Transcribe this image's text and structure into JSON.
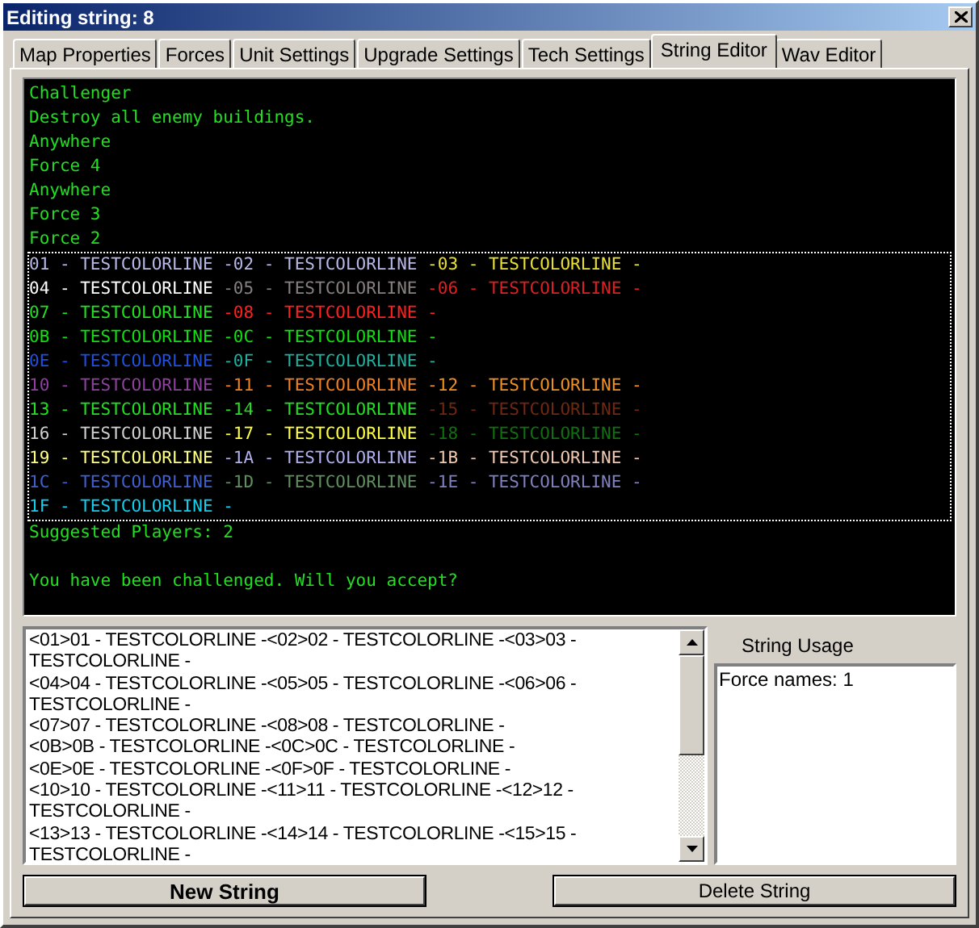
{
  "window": {
    "title": "Editing string: 8"
  },
  "tabs": [
    {
      "label": "Map Properties",
      "selected": false
    },
    {
      "label": "Forces",
      "selected": false
    },
    {
      "label": "Unit Settings",
      "selected": false
    },
    {
      "label": "Upgrade Settings",
      "selected": false
    },
    {
      "label": "Tech Settings",
      "selected": false
    },
    {
      "label": "String Editor",
      "selected": true
    },
    {
      "label": "Wav Editor",
      "selected": false
    }
  ],
  "string_list": [
    {
      "kind": "text",
      "selected": false,
      "text": "Challenger"
    },
    {
      "kind": "text",
      "selected": false,
      "text": "Destroy all enemy buildings."
    },
    {
      "kind": "text",
      "selected": false,
      "text": "Anywhere"
    },
    {
      "kind": "text",
      "selected": false,
      "text": "Force 4"
    },
    {
      "kind": "text",
      "selected": false,
      "text": "Anywhere"
    },
    {
      "kind": "text",
      "selected": false,
      "text": "Force 3"
    },
    {
      "kind": "text",
      "selected": false,
      "text": "Force 2"
    },
    {
      "kind": "colored",
      "selected": true,
      "lines": [
        [
          {
            "text": "01 - TESTCOLORLINE ",
            "color": "#b8b8e8"
          },
          {
            "text": "-02 - TESTCOLORLINE ",
            "color": "#b8b8e8"
          },
          {
            "text": "-03 - TESTCOLORLINE -",
            "color": "#e8e030"
          }
        ],
        [
          {
            "text": "04 - TESTCOLORLINE ",
            "color": "#ffffff"
          },
          {
            "text": "-05 - TESTCOLORLINE ",
            "color": "#888080"
          },
          {
            "text": "-06 - TESTCOLORLINE -",
            "color": "#e02020"
          }
        ],
        [
          {
            "text": "07 - TESTCOLORLINE ",
            "color": "#20e020"
          },
          {
            "text": "-08 - TESTCOLORLINE -",
            "color": "#ff2020"
          }
        ],
        [
          {
            "text": "0B - TESTCOLORLINE ",
            "color": "#10e010"
          },
          {
            "text": "-0C - TESTCOLORLINE -",
            "color": "#10e010"
          }
        ],
        [
          {
            "text": "0E - TESTCOLORLINE ",
            "color": "#2050e0"
          },
          {
            "text": "-0F - TESTCOLORLINE -",
            "color": "#20b0a0"
          }
        ],
        [
          {
            "text": "10 - TESTCOLORLINE ",
            "color": "#9040a0"
          },
          {
            "text": "-11 - TESTCOLORLINE ",
            "color": "#f08020"
          },
          {
            "text": "-12 - TESTCOLORLINE -",
            "color": "#f09020"
          }
        ],
        [
          {
            "text": "13 - TESTCOLORLINE ",
            "color": "#20e020"
          },
          {
            "text": "-14 - TESTCOLORLINE ",
            "color": "#20e020"
          },
          {
            "text": "-15 - TESTCOLORLINE -",
            "color": "#702810"
          }
        ],
        [
          {
            "text": "16 - TESTCOLORLINE ",
            "color": "#d0d0d0"
          },
          {
            "text": "-17 - TESTCOLORLINE ",
            "color": "#ffff40"
          },
          {
            "text": "-18 - TESTCOLORLINE -",
            "color": "#107010"
          }
        ],
        [
          {
            "text": "19 - TESTCOLORLINE ",
            "color": "#ffff80"
          },
          {
            "text": "-1A - TESTCOLORLINE ",
            "color": "#b0b0f0"
          },
          {
            "text": "-1B - TESTCOLORLINE -",
            "color": "#f0c8b0"
          }
        ],
        [
          {
            "text": "1C - TESTCOLORLINE ",
            "color": "#4060d0"
          },
          {
            "text": "-1D - TESTCOLORLINE ",
            "color": "#609060"
          },
          {
            "text": "-1E - TESTCOLORLINE -",
            "color": "#8080c0"
          }
        ],
        [
          {
            "text": "1F - TESTCOLORLINE -",
            "color": "#10d0f0"
          }
        ]
      ]
    },
    {
      "kind": "text",
      "selected": false,
      "text": "Suggested Players: 2\n\nYou have been challenged. Will you accept?"
    }
  ],
  "editor": {
    "lines": [
      "<01>01 - TESTCOLORLINE -<02>02 - TESTCOLORLINE -<03>03 -",
      "TESTCOLORLINE -",
      "<04>04 - TESTCOLORLINE -<05>05 - TESTCOLORLINE -<06>06 -",
      "TESTCOLORLINE -",
      "<07>07 - TESTCOLORLINE -<08>08 - TESTCOLORLINE -",
      "<0B>0B - TESTCOLORLINE -<0C>0C - TESTCOLORLINE -",
      "<0E>0E - TESTCOLORLINE -<0F>0F - TESTCOLORLINE -",
      "<10>10 - TESTCOLORLINE -<11>11 - TESTCOLORLINE -<12>12 -",
      "TESTCOLORLINE -",
      "<13>13 - TESTCOLORLINE -<14>14 - TESTCOLORLINE -<15>15 -",
      "TESTCOLORLINE -"
    ]
  },
  "string_usage": {
    "label": "String Usage",
    "items": [
      "Force names: 1"
    ]
  },
  "buttons": [
    {
      "label": "New String",
      "default": true
    },
    {
      "label": "Delete String",
      "default": false
    }
  ]
}
